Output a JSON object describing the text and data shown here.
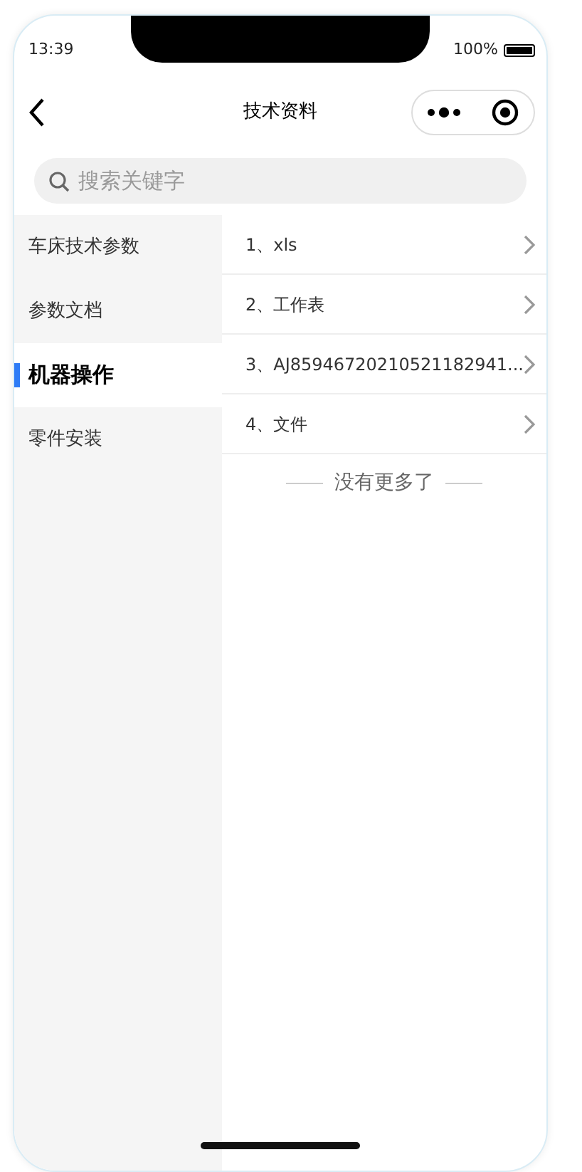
{
  "status_bar": {
    "time": "13:39",
    "battery": "100%"
  },
  "nav": {
    "title": "技术资料"
  },
  "search": {
    "placeholder": "搜索关键字"
  },
  "sidebar": {
    "items": [
      {
        "label": "车床技术参数",
        "selected": false
      },
      {
        "label": "参数文档",
        "selected": false
      },
      {
        "label": "机器操作",
        "selected": true
      },
      {
        "label": "零件安装",
        "selected": false
      }
    ]
  },
  "files": [
    {
      "label": "1、xls"
    },
    {
      "label": "2、工作表"
    },
    {
      "label": "3、AJ85946720210521182941..."
    },
    {
      "label": "4、文件"
    }
  ],
  "end_text": "没有更多了"
}
